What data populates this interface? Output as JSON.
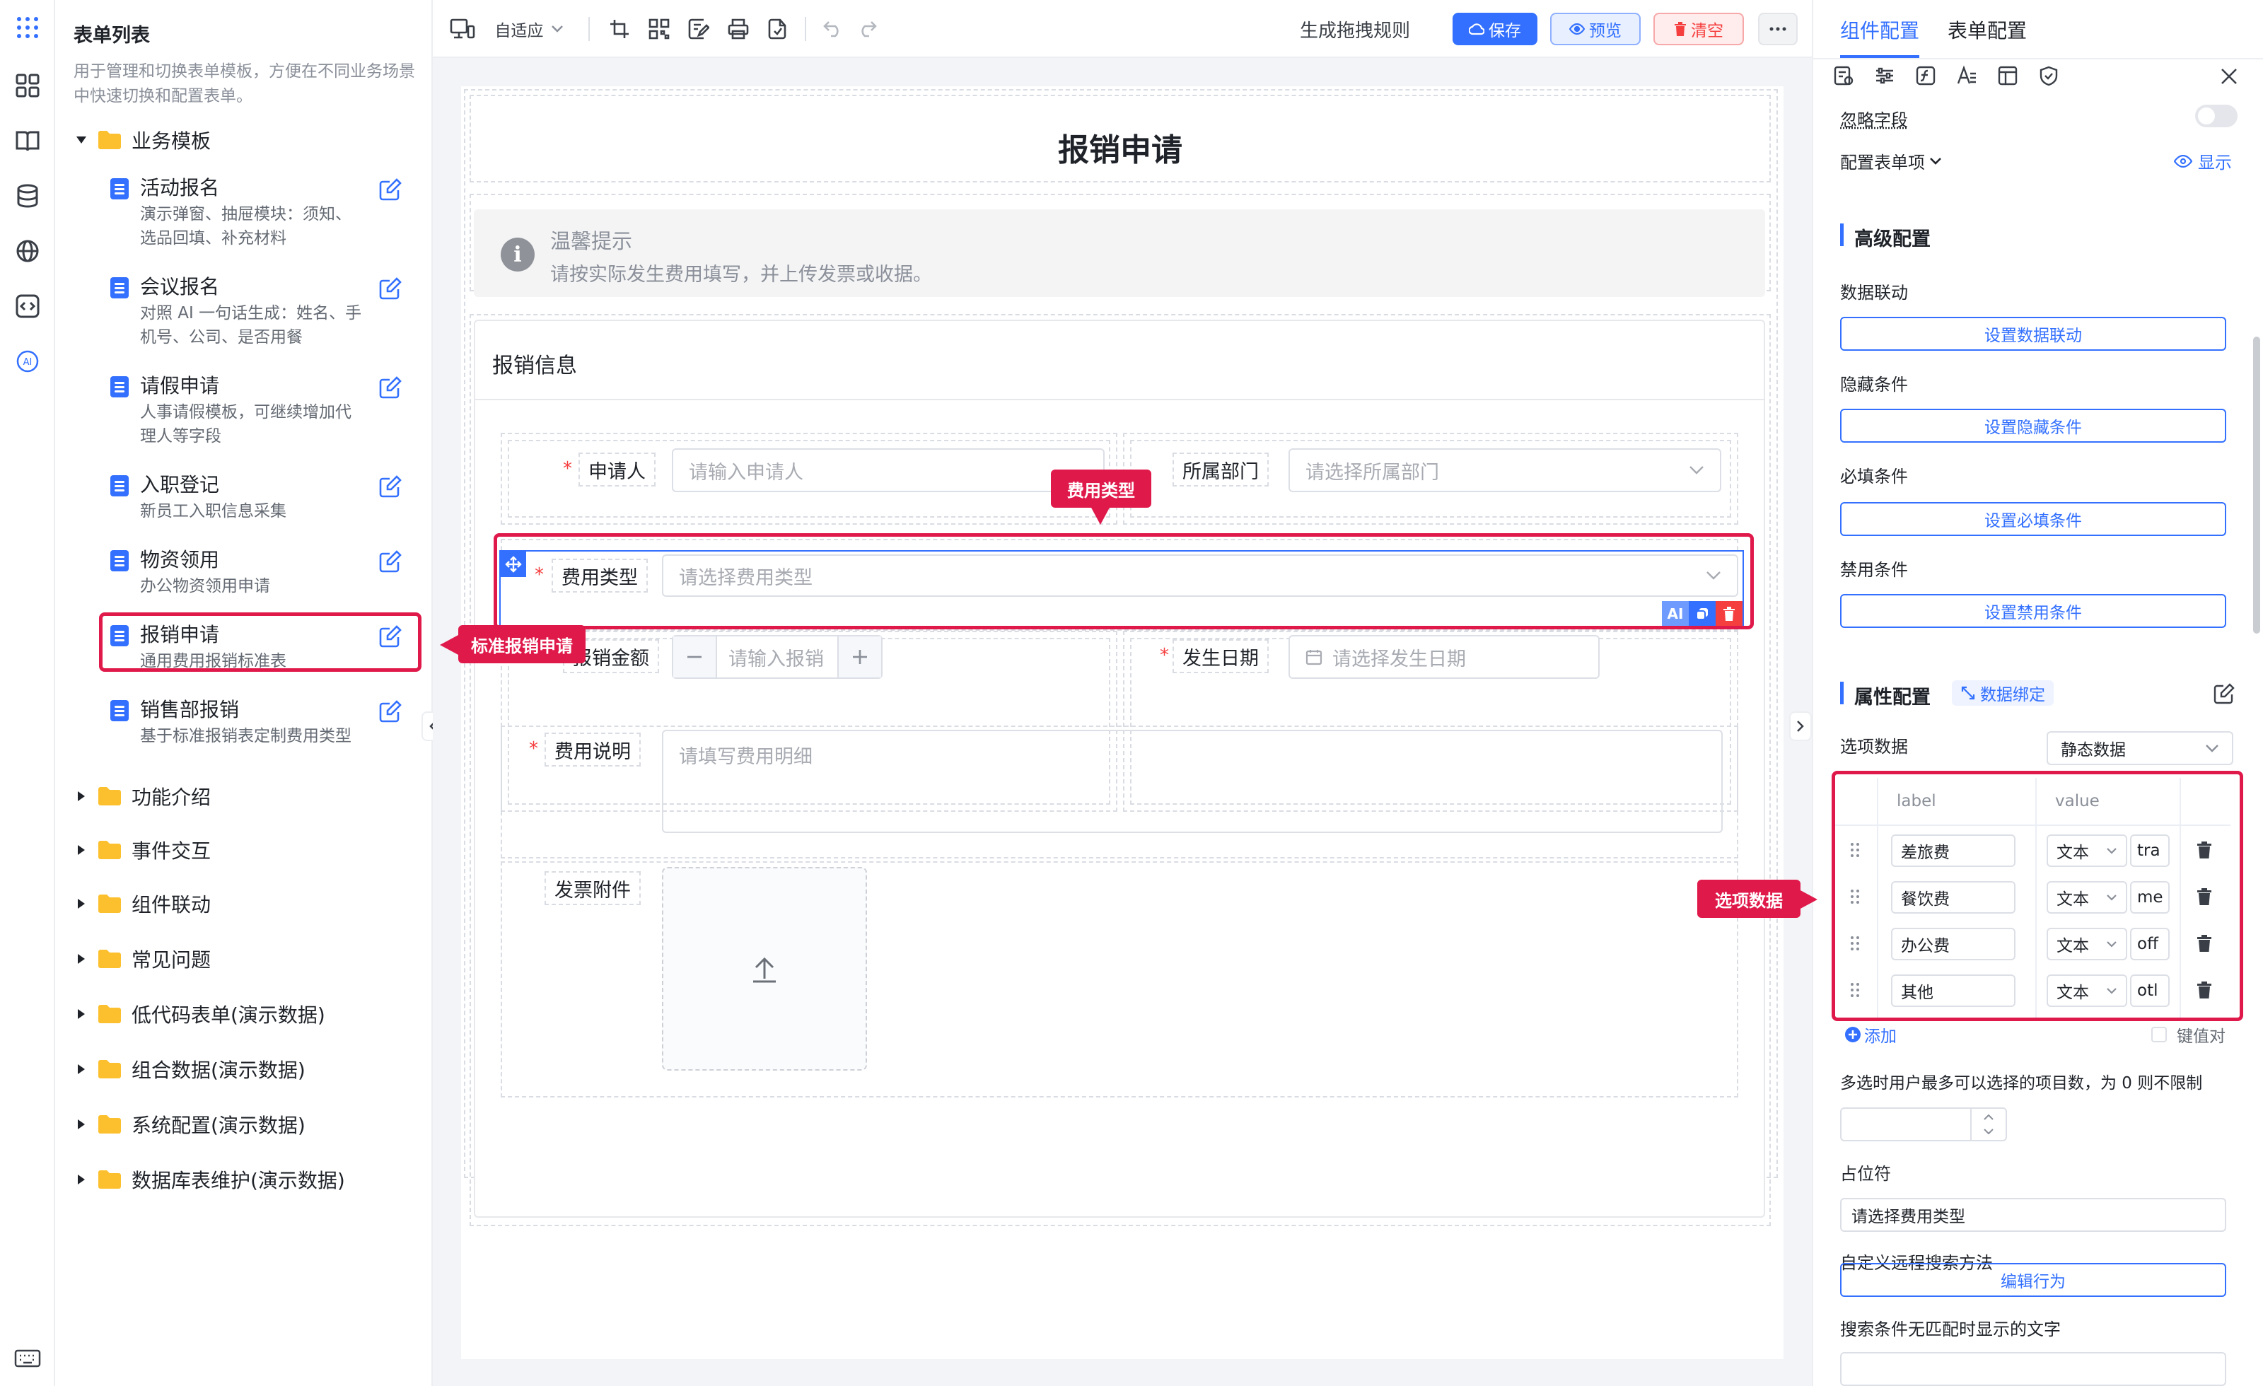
{
  "sidebar": {
    "title": "表单列表",
    "description": "用于管理和切换表单模板，方便在不同业务场景中快速切换和配置表单。",
    "group_business": "业务模板",
    "templates": [
      {
        "title": "活动报名",
        "desc": "演示弹窗、抽屉模块：须知、选品回填、补充材料"
      },
      {
        "title": "会议报名",
        "desc": "对照 AI 一句话生成：姓名、手机号、公司、是否用餐"
      },
      {
        "title": "请假申请",
        "desc": "人事请假模板，可继续增加代理人等字段"
      },
      {
        "title": "入职登记",
        "desc": "新员工入职信息采集"
      },
      {
        "title": "物资领用",
        "desc": "办公物资领用申请"
      },
      {
        "title": "报销申请",
        "desc": "通用费用报销标准表"
      },
      {
        "title": "销售部报销",
        "desc": "基于标准报销表定制费用类型"
      }
    ],
    "groups": [
      "功能介绍",
      "事件交互",
      "组件联动",
      "常见问题",
      "低代码表单(演示数据)",
      "组合数据(演示数据)",
      "系统配置(演示数据)",
      "数据库表维护(演示数据)"
    ]
  },
  "toolbar": {
    "adapt": "自适应",
    "gen_rules": "生成拖拽规则",
    "save": "保存",
    "preview": "预览",
    "clear": "清空"
  },
  "form": {
    "title": "报销申请",
    "tip_title": "温馨提示",
    "tip_text": "请按实际发生费用填写，并上传发票或收据。",
    "section": "报销信息",
    "applicant_label": "申请人",
    "applicant_ph": "请输入申请人",
    "dept_label": "所属部门",
    "dept_ph": "请选择所属部门",
    "type_label": "费用类型",
    "type_ph": "请选择费用类型",
    "amount_label": "报销金额",
    "amount_ph": "请输入报销",
    "date_label": "发生日期",
    "date_ph": "请选择发生日期",
    "desc_label": "费用说明",
    "desc_ph": "请填写费用明细",
    "attach_label": "发票附件"
  },
  "callouts": {
    "type": "费用类型",
    "template": "标准报销申请",
    "options": "选项数据"
  },
  "panel": {
    "tab_component": "组件配置",
    "tab_form": "表单配置",
    "ignore_field": "忽略字段",
    "config_items": "配置表单项",
    "show": "显示",
    "advanced": "高级配置",
    "data_link": "数据联动",
    "data_link_btn": "设置数据联动",
    "hide_cond": "隐藏条件",
    "hide_btn": "设置隐藏条件",
    "req_cond": "必填条件",
    "req_btn": "设置必填条件",
    "dis_cond": "禁用条件",
    "dis_btn": "设置禁用条件",
    "props": "属性配置",
    "data_bind": "数据绑定",
    "options_label": "选项数据",
    "options_source": "静态数据",
    "col_label": "label",
    "col_value": "value",
    "rows": [
      {
        "label": "差旅费",
        "type": "文本",
        "value": "tra"
      },
      {
        "label": "餐饮费",
        "type": "文本",
        "value": "me"
      },
      {
        "label": "办公费",
        "type": "文本",
        "value": "off"
      },
      {
        "label": "其他",
        "type": "文本",
        "value": "otl"
      }
    ],
    "add": "添加",
    "kv": "键值对",
    "multi_limit": "多选时用户最多可以选择的项目数，为 0 则不限制",
    "placeholder": "占位符",
    "placeholder_val": "请选择费用类型",
    "remote": "自定义远程搜索方法",
    "edit_behavior": "编辑行为",
    "no_match": "搜索条件无匹配时显示的文字"
  },
  "colors": {
    "accent": "#3370ff",
    "danger": "#f53f3f",
    "callout": "#e0194b"
  }
}
